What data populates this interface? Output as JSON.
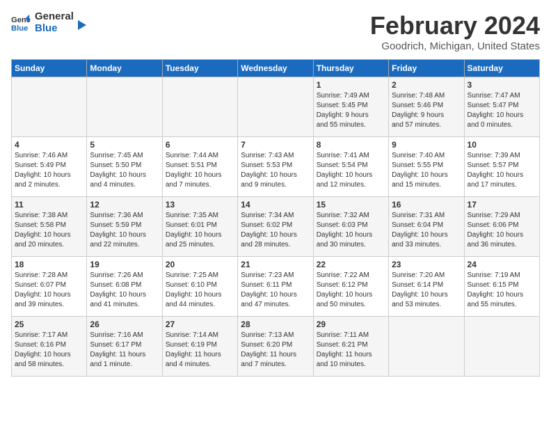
{
  "header": {
    "logo_line1": "General",
    "logo_line2": "Blue",
    "title": "February 2024",
    "subtitle": "Goodrich, Michigan, United States"
  },
  "weekdays": [
    "Sunday",
    "Monday",
    "Tuesday",
    "Wednesday",
    "Thursday",
    "Friday",
    "Saturday"
  ],
  "weeks": [
    [
      {
        "day": "",
        "info": ""
      },
      {
        "day": "",
        "info": ""
      },
      {
        "day": "",
        "info": ""
      },
      {
        "day": "",
        "info": ""
      },
      {
        "day": "1",
        "info": "Sunrise: 7:49 AM\nSunset: 5:45 PM\nDaylight: 9 hours\nand 55 minutes."
      },
      {
        "day": "2",
        "info": "Sunrise: 7:48 AM\nSunset: 5:46 PM\nDaylight: 9 hours\nand 57 minutes."
      },
      {
        "day": "3",
        "info": "Sunrise: 7:47 AM\nSunset: 5:47 PM\nDaylight: 10 hours\nand 0 minutes."
      }
    ],
    [
      {
        "day": "4",
        "info": "Sunrise: 7:46 AM\nSunset: 5:49 PM\nDaylight: 10 hours\nand 2 minutes."
      },
      {
        "day": "5",
        "info": "Sunrise: 7:45 AM\nSunset: 5:50 PM\nDaylight: 10 hours\nand 4 minutes."
      },
      {
        "day": "6",
        "info": "Sunrise: 7:44 AM\nSunset: 5:51 PM\nDaylight: 10 hours\nand 7 minutes."
      },
      {
        "day": "7",
        "info": "Sunrise: 7:43 AM\nSunset: 5:53 PM\nDaylight: 10 hours\nand 9 minutes."
      },
      {
        "day": "8",
        "info": "Sunrise: 7:41 AM\nSunset: 5:54 PM\nDaylight: 10 hours\nand 12 minutes."
      },
      {
        "day": "9",
        "info": "Sunrise: 7:40 AM\nSunset: 5:55 PM\nDaylight: 10 hours\nand 15 minutes."
      },
      {
        "day": "10",
        "info": "Sunrise: 7:39 AM\nSunset: 5:57 PM\nDaylight: 10 hours\nand 17 minutes."
      }
    ],
    [
      {
        "day": "11",
        "info": "Sunrise: 7:38 AM\nSunset: 5:58 PM\nDaylight: 10 hours\nand 20 minutes."
      },
      {
        "day": "12",
        "info": "Sunrise: 7:36 AM\nSunset: 5:59 PM\nDaylight: 10 hours\nand 22 minutes."
      },
      {
        "day": "13",
        "info": "Sunrise: 7:35 AM\nSunset: 6:01 PM\nDaylight: 10 hours\nand 25 minutes."
      },
      {
        "day": "14",
        "info": "Sunrise: 7:34 AM\nSunset: 6:02 PM\nDaylight: 10 hours\nand 28 minutes."
      },
      {
        "day": "15",
        "info": "Sunrise: 7:32 AM\nSunset: 6:03 PM\nDaylight: 10 hours\nand 30 minutes."
      },
      {
        "day": "16",
        "info": "Sunrise: 7:31 AM\nSunset: 6:04 PM\nDaylight: 10 hours\nand 33 minutes."
      },
      {
        "day": "17",
        "info": "Sunrise: 7:29 AM\nSunset: 6:06 PM\nDaylight: 10 hours\nand 36 minutes."
      }
    ],
    [
      {
        "day": "18",
        "info": "Sunrise: 7:28 AM\nSunset: 6:07 PM\nDaylight: 10 hours\nand 39 minutes."
      },
      {
        "day": "19",
        "info": "Sunrise: 7:26 AM\nSunset: 6:08 PM\nDaylight: 10 hours\nand 41 minutes."
      },
      {
        "day": "20",
        "info": "Sunrise: 7:25 AM\nSunset: 6:10 PM\nDaylight: 10 hours\nand 44 minutes."
      },
      {
        "day": "21",
        "info": "Sunrise: 7:23 AM\nSunset: 6:11 PM\nDaylight: 10 hours\nand 47 minutes."
      },
      {
        "day": "22",
        "info": "Sunrise: 7:22 AM\nSunset: 6:12 PM\nDaylight: 10 hours\nand 50 minutes."
      },
      {
        "day": "23",
        "info": "Sunrise: 7:20 AM\nSunset: 6:14 PM\nDaylight: 10 hours\nand 53 minutes."
      },
      {
        "day": "24",
        "info": "Sunrise: 7:19 AM\nSunset: 6:15 PM\nDaylight: 10 hours\nand 55 minutes."
      }
    ],
    [
      {
        "day": "25",
        "info": "Sunrise: 7:17 AM\nSunset: 6:16 PM\nDaylight: 10 hours\nand 58 minutes."
      },
      {
        "day": "26",
        "info": "Sunrise: 7:16 AM\nSunset: 6:17 PM\nDaylight: 11 hours\nand 1 minute."
      },
      {
        "day": "27",
        "info": "Sunrise: 7:14 AM\nSunset: 6:19 PM\nDaylight: 11 hours\nand 4 minutes."
      },
      {
        "day": "28",
        "info": "Sunrise: 7:13 AM\nSunset: 6:20 PM\nDaylight: 11 hours\nand 7 minutes."
      },
      {
        "day": "29",
        "info": "Sunrise: 7:11 AM\nSunset: 6:21 PM\nDaylight: 11 hours\nand 10 minutes."
      },
      {
        "day": "",
        "info": ""
      },
      {
        "day": "",
        "info": ""
      }
    ]
  ]
}
